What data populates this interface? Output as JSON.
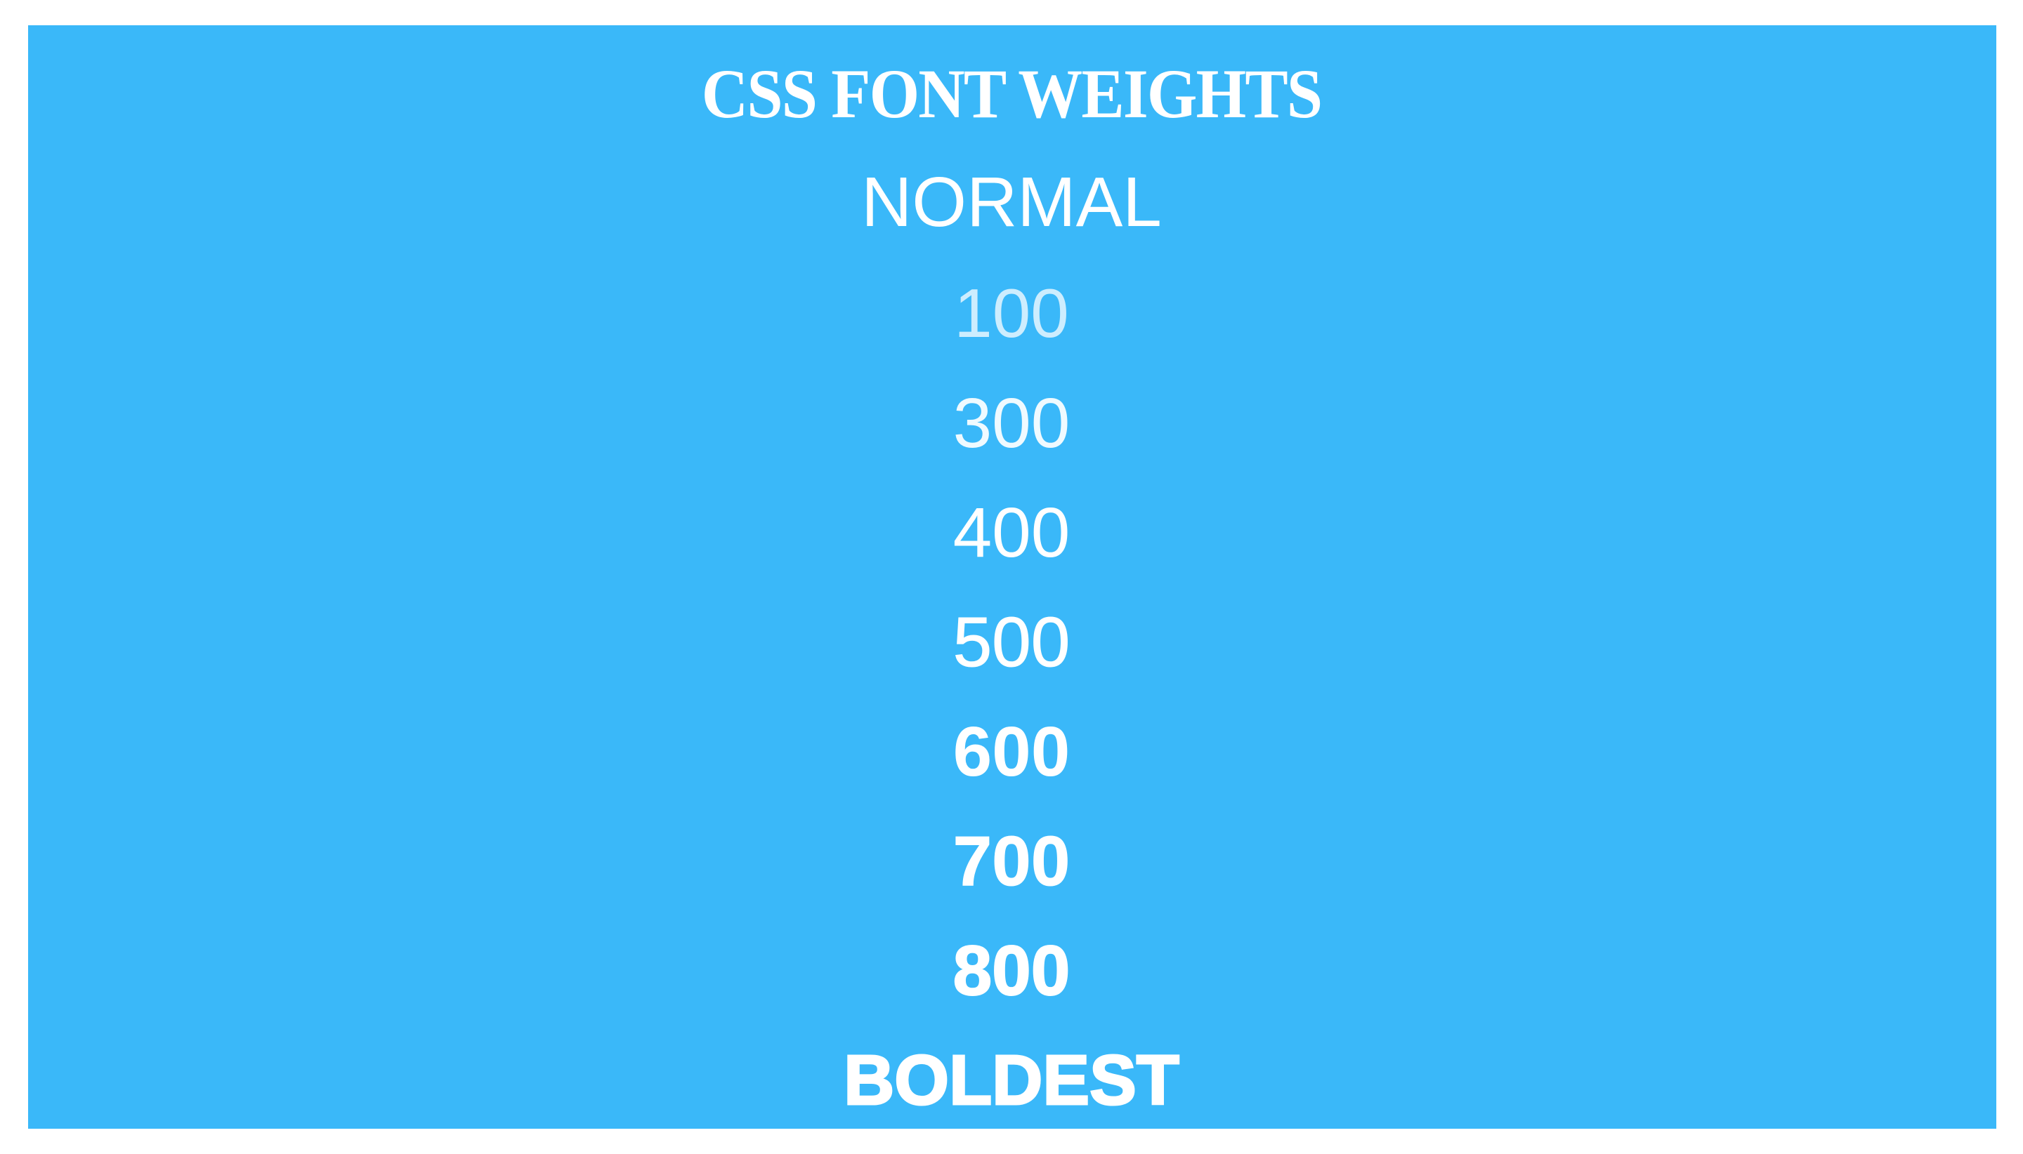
{
  "title": "CSS FONT WEIGHTS",
  "weights": [
    {
      "label": "NORMAL"
    },
    {
      "label": "100"
    },
    {
      "label": "300"
    },
    {
      "label": "400"
    },
    {
      "label": "500"
    },
    {
      "label": "600"
    },
    {
      "label": "700"
    },
    {
      "label": "800"
    },
    {
      "label": "BOLDEST"
    }
  ],
  "colors": {
    "background": "#3ab8f9",
    "text": "#ffffff"
  }
}
